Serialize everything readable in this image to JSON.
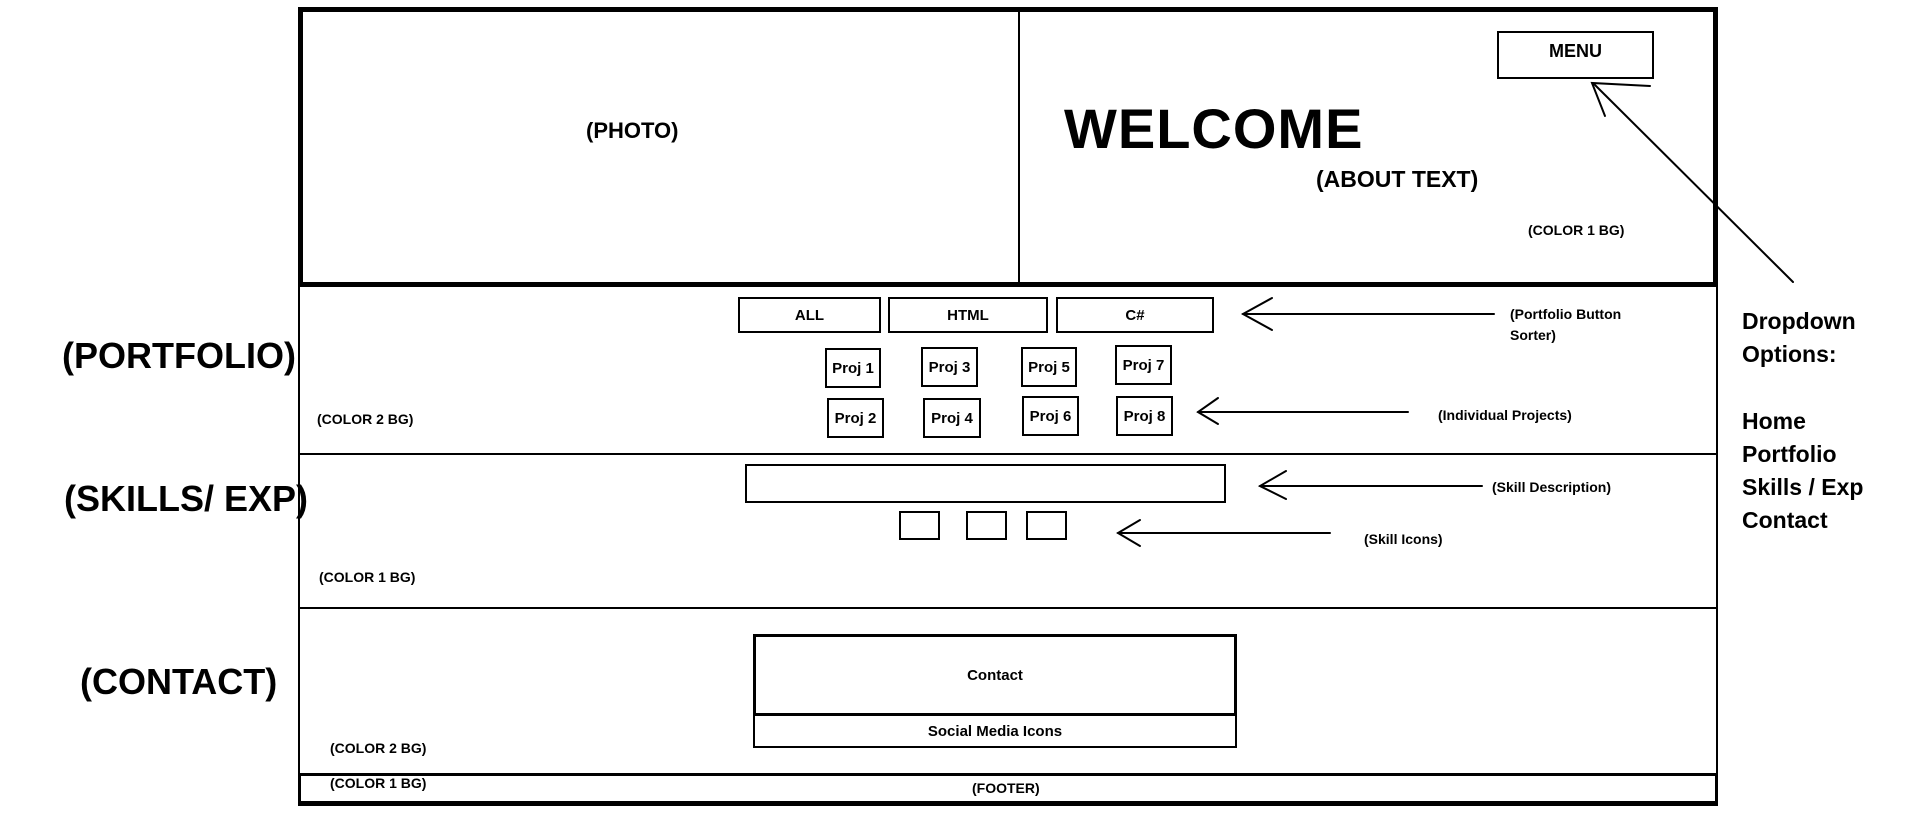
{
  "header": {
    "photo": "(PHOTO)",
    "welcome": "WELCOME",
    "about": "(ABOUT TEXT)",
    "bg_note": "(COLOR 1 BG)",
    "menu": "MENU"
  },
  "portfolio": {
    "section_label": "(PORTFOLIO)",
    "bg_note": "(COLOR 2 BG)",
    "filters": [
      "ALL",
      "HTML",
      "C#"
    ],
    "projects": [
      "Proj 1",
      "Proj 3",
      "Proj 5",
      "Proj 7",
      "Proj 2",
      "Proj 4",
      "Proj 6",
      "Proj 8"
    ],
    "sorter_note_line1": "(Portfolio Button",
    "sorter_note_line2": "Sorter)",
    "projects_note": "(Individual Projects)"
  },
  "skills": {
    "section_label": "(SKILLS/ EXP)",
    "bg_note": "(COLOR 1 BG)",
    "description_note": "(Skill Description)",
    "icons_note": "(Skill Icons)"
  },
  "contact": {
    "section_label": "(CONTACT)",
    "bg_note": "(COLOR 2 BG)",
    "contact_label": "Contact",
    "social_label": "Social Media Icons"
  },
  "footer": {
    "bg_note": "(COLOR 1 BG)",
    "label": "(FOOTER)"
  },
  "dropdown": {
    "title_line1": "Dropdown",
    "title_line2": "Options:",
    "options": [
      "Home",
      "Portfolio",
      "Skills / Exp",
      "Contact"
    ]
  }
}
